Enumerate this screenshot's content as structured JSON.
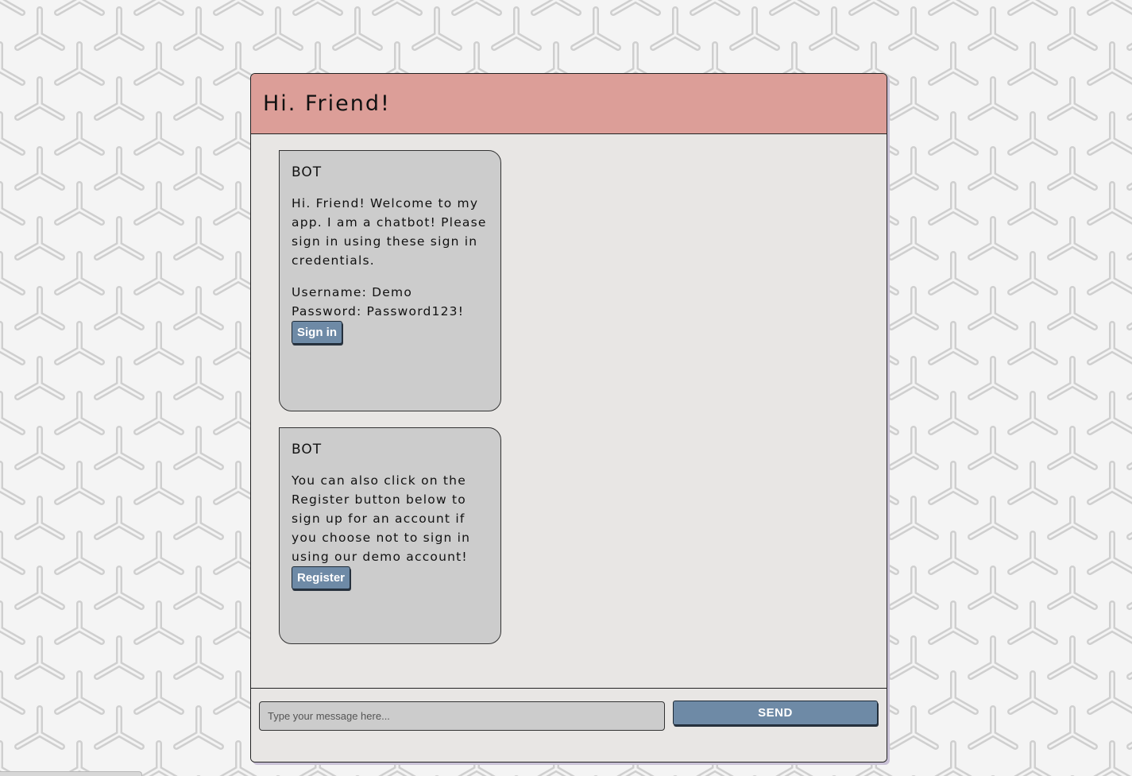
{
  "header": {
    "title": "Hi. Friend!"
  },
  "messages": [
    {
      "sender": "BOT",
      "paragraphs": [
        "Hi. Friend! Welcome to my app. I am a chatbot! Please sign in using these sign in credentials.",
        "Username: Demo\nPassword: Password123!"
      ],
      "button_label": "Sign in"
    },
    {
      "sender": "BOT",
      "paragraphs": [
        "You can also click on the Register button below to sign up for an account if you choose not to sign in using our demo account!"
      ],
      "button_label": "Register"
    }
  ],
  "composer": {
    "placeholder": "Type your message here...",
    "value": "",
    "send_label": "SEND"
  },
  "colors": {
    "header_bg": "#dc9e98",
    "window_bg": "#e8e6e4",
    "bubble_bg": "#cccccc",
    "button_bg": "#6e8aa6",
    "page_pattern": "#c7c7c7"
  }
}
